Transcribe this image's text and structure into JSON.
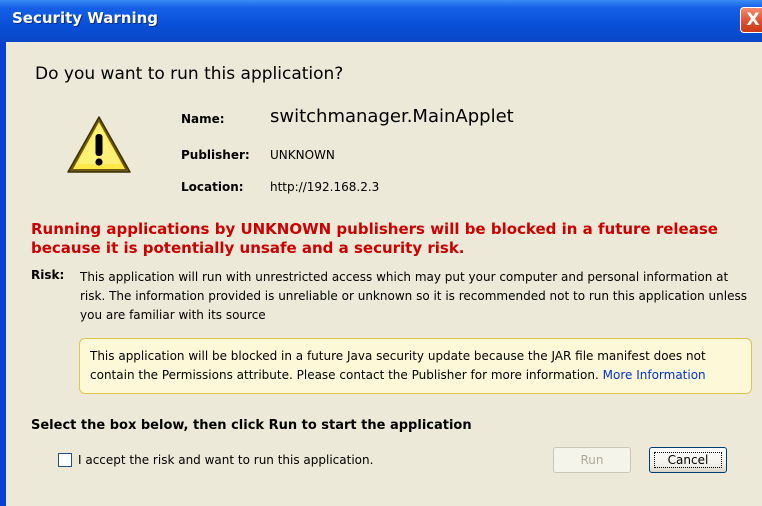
{
  "window": {
    "title": "Security Warning",
    "close_symbol": "X"
  },
  "dialog": {
    "heading": "Do you want to run this application?",
    "icon": "warning-triangle-icon",
    "fields": {
      "name_label": "Name:",
      "name_value": "switchmanager.MainApplet",
      "publisher_label": "Publisher:",
      "publisher_value": "UNKNOWN",
      "location_label": "Location:",
      "location_value": "http://192.168.2.3"
    },
    "red_warning": "Running applications by UNKNOWN publishers will be blocked in a future release because it is potentially unsafe and a security risk.",
    "risk_label": "Risk:",
    "risk_text": "This application will run with unrestricted access which may put your computer and personal information at risk. The information provided is unreliable or unknown so it is recommended not to run this application unless you are familiar with its source",
    "info_box": {
      "text": "This application will be blocked in a future Java security update because the JAR file manifest does not contain the Permissions attribute. Please contact the Publisher for more information.",
      "link": "More Information"
    },
    "instruction": "Select the box below, then click Run to start the application",
    "accept_checkbox": {
      "label": "I accept the risk and want to run this application.",
      "checked": false
    },
    "buttons": {
      "run": "Run",
      "cancel": "Cancel"
    }
  },
  "colors": {
    "titlebar": "#0850d8",
    "dialog_bg": "#ece9d8",
    "warning_red": "#cc0000",
    "info_bg": "#fdf9d8",
    "link": "#0033cc"
  }
}
